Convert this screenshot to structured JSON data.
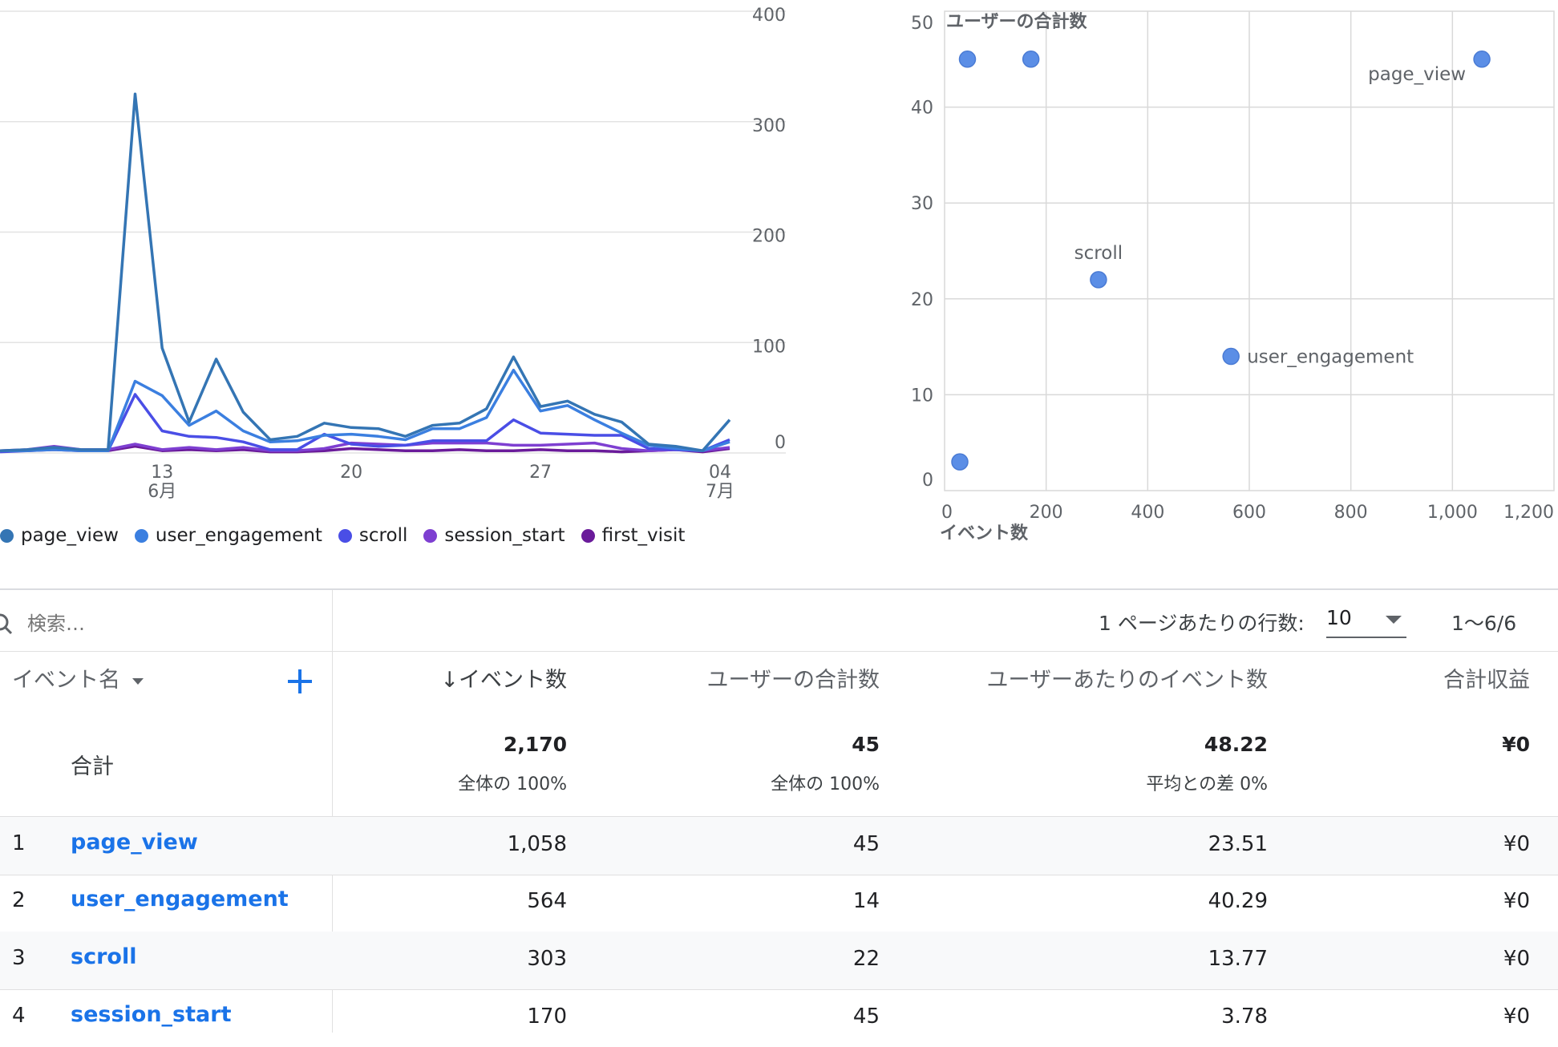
{
  "line_chart": {
    "chart_data": {
      "type": "line",
      "x_ticks": [
        {
          "day": "13",
          "month": "6月"
        },
        {
          "day": "20",
          "month": ""
        },
        {
          "day": "27",
          "month": ""
        },
        {
          "day": "04",
          "month": "7月"
        }
      ],
      "y_ticks": [
        "400",
        "300",
        "200",
        "100",
        "0"
      ],
      "ylim": [
        0,
        400
      ],
      "series": [
        {
          "name": "page_view",
          "color": "#3475b4",
          "values": [
            2,
            3,
            5,
            3,
            3,
            325,
            95,
            28,
            85,
            37,
            12,
            15,
            27,
            23,
            22,
            15,
            25,
            27,
            40,
            87,
            42,
            47,
            35,
            28,
            8,
            6,
            2,
            30
          ]
        },
        {
          "name": "user_engagement",
          "color": "#3b7fe0",
          "values": [
            2,
            2,
            3,
            2,
            2,
            65,
            52,
            25,
            38,
            20,
            10,
            11,
            16,
            17,
            15,
            12,
            22,
            22,
            32,
            75,
            38,
            43,
            30,
            18,
            7,
            4,
            2,
            10
          ]
        },
        {
          "name": "scroll",
          "color": "#4a4ee6",
          "values": [
            1,
            2,
            4,
            2,
            2,
            53,
            20,
            15,
            14,
            10,
            3,
            3,
            17,
            8,
            6,
            7,
            11,
            11,
            11,
            30,
            18,
            17,
            16,
            16,
            4,
            3,
            2,
            12
          ]
        },
        {
          "name": "session_start",
          "color": "#7e3fd1",
          "values": [
            2,
            3,
            6,
            3,
            3,
            8,
            3,
            5,
            3,
            5,
            2,
            2,
            4,
            9,
            8,
            7,
            9,
            9,
            9,
            7,
            7,
            8,
            9,
            4,
            2,
            3,
            2,
            5
          ]
        },
        {
          "name": "first_visit",
          "color": "#6a1b9a",
          "values": [
            2,
            2,
            3,
            2,
            2,
            6,
            2,
            3,
            2,
            3,
            1,
            1,
            2,
            4,
            3,
            2,
            2,
            3,
            2,
            2,
            3,
            2,
            2,
            1,
            2,
            3,
            1,
            4
          ]
        }
      ]
    },
    "legend": [
      {
        "label": "page_view",
        "color": "#3475b4"
      },
      {
        "label": "user_engagement",
        "color": "#3b7fe0"
      },
      {
        "label": "scroll",
        "color": "#4a4ee6"
      },
      {
        "label": "session_start",
        "color": "#7e3fd1"
      },
      {
        "label": "first_visit",
        "color": "#6a1b9a"
      }
    ]
  },
  "scatter_chart": {
    "chart_data": {
      "type": "scatter",
      "ylabel": "ユーザーの合計数",
      "xlabel": "イベント数",
      "x_ticks": [
        "0",
        "200",
        "400",
        "600",
        "800",
        "1,000",
        "1,200"
      ],
      "y_ticks": [
        "50",
        "40",
        "30",
        "20",
        "10",
        "0"
      ],
      "xlim": [
        0,
        1200
      ],
      "ylim": [
        0,
        50
      ],
      "point_color": "#5b8ee6",
      "points": [
        {
          "x": 1058,
          "y": 45,
          "label": "page_view"
        },
        {
          "x": 564,
          "y": 14,
          "label": "user_engagement"
        },
        {
          "x": 303,
          "y": 22,
          "label": "scroll"
        },
        {
          "x": 170,
          "y": 45,
          "label": ""
        },
        {
          "x": 45,
          "y": 45,
          "label": ""
        },
        {
          "x": 30,
          "y": 3,
          "label": ""
        }
      ]
    }
  },
  "toolbar": {
    "search_placeholder": "検索…",
    "rows_per_page_label": "1 ページあたりの行数:",
    "rows_per_page_value": "10",
    "pagination": "1〜6/6"
  },
  "table": {
    "columns": {
      "event_name": "イベント名",
      "event_count": "↓イベント数",
      "total_users": "ユーザーの合計数",
      "events_per_user": "ユーザーあたりのイベント数",
      "total_revenue": "合計収益"
    },
    "totals": {
      "label": "合計",
      "event_count": "2,170",
      "event_count_sub": "全体の 100%",
      "total_users": "45",
      "total_users_sub": "全体の 100%",
      "events_per_user": "48.22",
      "events_per_user_sub": "平均との差 0%",
      "total_revenue": "¥0"
    },
    "rows": [
      {
        "index": "1",
        "name": "page_view",
        "event_count": "1,058",
        "total_users": "45",
        "events_per_user": "23.51",
        "total_revenue": "¥0"
      },
      {
        "index": "2",
        "name": "user_engagement",
        "event_count": "564",
        "total_users": "14",
        "events_per_user": "40.29",
        "total_revenue": "¥0"
      },
      {
        "index": "3",
        "name": "scroll",
        "event_count": "303",
        "total_users": "22",
        "events_per_user": "13.77",
        "total_revenue": "¥0"
      },
      {
        "index": "4",
        "name": "session_start",
        "event_count": "170",
        "total_users": "45",
        "events_per_user": "3.78",
        "total_revenue": "¥0"
      }
    ]
  }
}
